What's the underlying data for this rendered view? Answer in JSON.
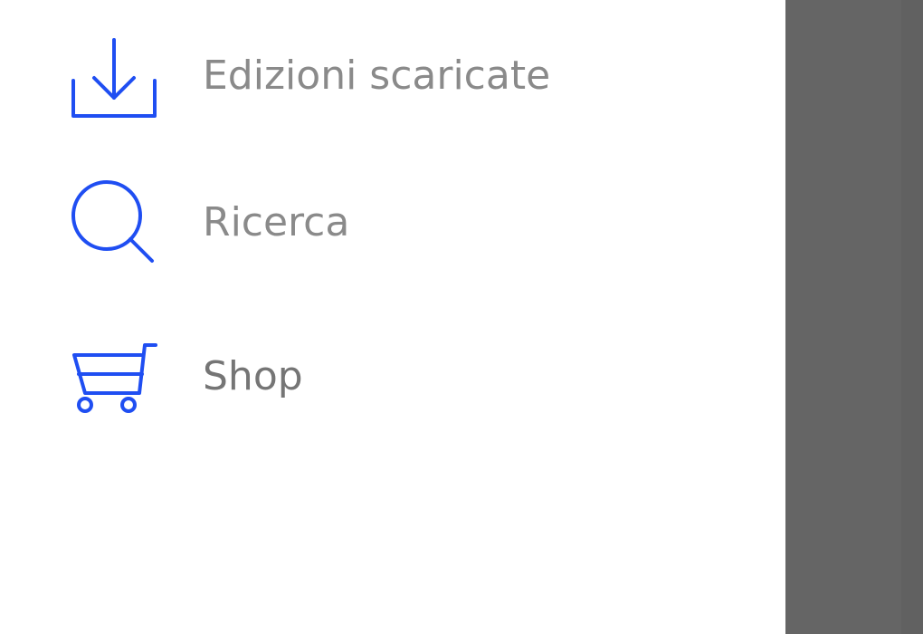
{
  "menu": {
    "items": [
      {
        "label": "Edizioni scaricate",
        "icon": "download-icon"
      },
      {
        "label": "Ricerca",
        "icon": "search-icon"
      },
      {
        "label": "Shop",
        "icon": "cart-icon"
      }
    ]
  },
  "colors": {
    "accent": "#1f4ef2",
    "label_text": "#8a8a8a",
    "label_text_shop": "#757575",
    "drawer_background": "#ffffff",
    "scrim": "#656565"
  }
}
